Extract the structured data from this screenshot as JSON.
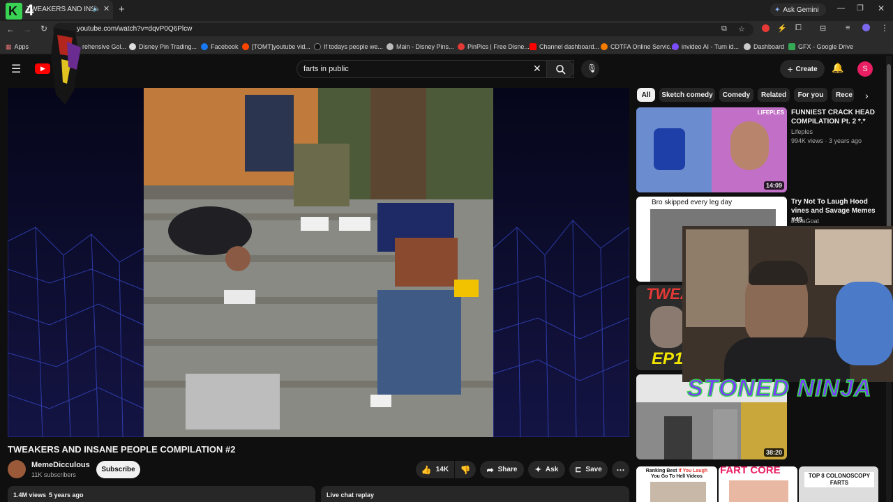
{
  "browser": {
    "tab_title": "TWEAKERS AND INSANE PE",
    "url": "youtube.com/watch?v=dqvP0Q6Plcw",
    "ask_gemini": "Ask Gemini",
    "bookmarks": [
      "Apps",
      "rehensive Gol...",
      "Disney Pin Trading...",
      "Facebook",
      "[TOMT]youtube vid...",
      "If todays people we...",
      "Main - Disney Pins...",
      "PinPics | Free Disne...",
      "Channel dashboard...",
      "CDTFA Online Servic...",
      "invideo AI - Turn id...",
      "Dashboard",
      "GFX - Google Drive"
    ]
  },
  "youtube": {
    "search_value": "farts in public",
    "create_label": "Create",
    "avatar_letter": "S",
    "chips": [
      "All",
      "Sketch comedy",
      "Comedy",
      "Related",
      "For you",
      "Rece"
    ]
  },
  "video": {
    "title": "TWEAKERS AND INSANE PEOPLE COMPILATION #2",
    "channel": "MemeDicculous",
    "subscribers": "11K subscribers",
    "subscribe_label": "Subscribe",
    "likes": "14K",
    "share_label": "Share",
    "ask_label": "Ask",
    "save_label": "Save",
    "views": "1.4M views",
    "age": "5 years ago",
    "live_chat": "Live chat replay"
  },
  "recommendations": [
    {
      "title": "FUNNIEST CRACK HEAD COMPILATION Pt. 2 *.*",
      "channel": "Lifeples",
      "meta": "994K views · 3 years ago",
      "duration": "14:09",
      "badge": "LIFEPLES"
    },
    {
      "title": "Try Not To Laugh Hood vines and Savage Memes #45",
      "channel": "JcDaGoat",
      "caption": "Bro skipped every leg day"
    },
    {
      "overlay": "TWEA",
      "overlay2": "EP1"
    },
    {
      "duration": "38:20"
    }
  ],
  "bottom_thumbs": [
    {
      "line1": "Ranking Best",
      "line2": "If You Laugh",
      "line3": "You Go To Hell Videos"
    },
    {
      "text": "FART CORE"
    },
    {
      "text": "TOP 8 COLONOSCOPY FARTS"
    }
  ],
  "overlays": {
    "stream_logo": "4",
    "webcam_banner": "STONED NINJA"
  },
  "colors": {
    "youtube_red": "#ff0000",
    "stream_green": "#39d353",
    "ninja_purple": "#7a3cff",
    "avatar_pink": "#e91e63"
  }
}
